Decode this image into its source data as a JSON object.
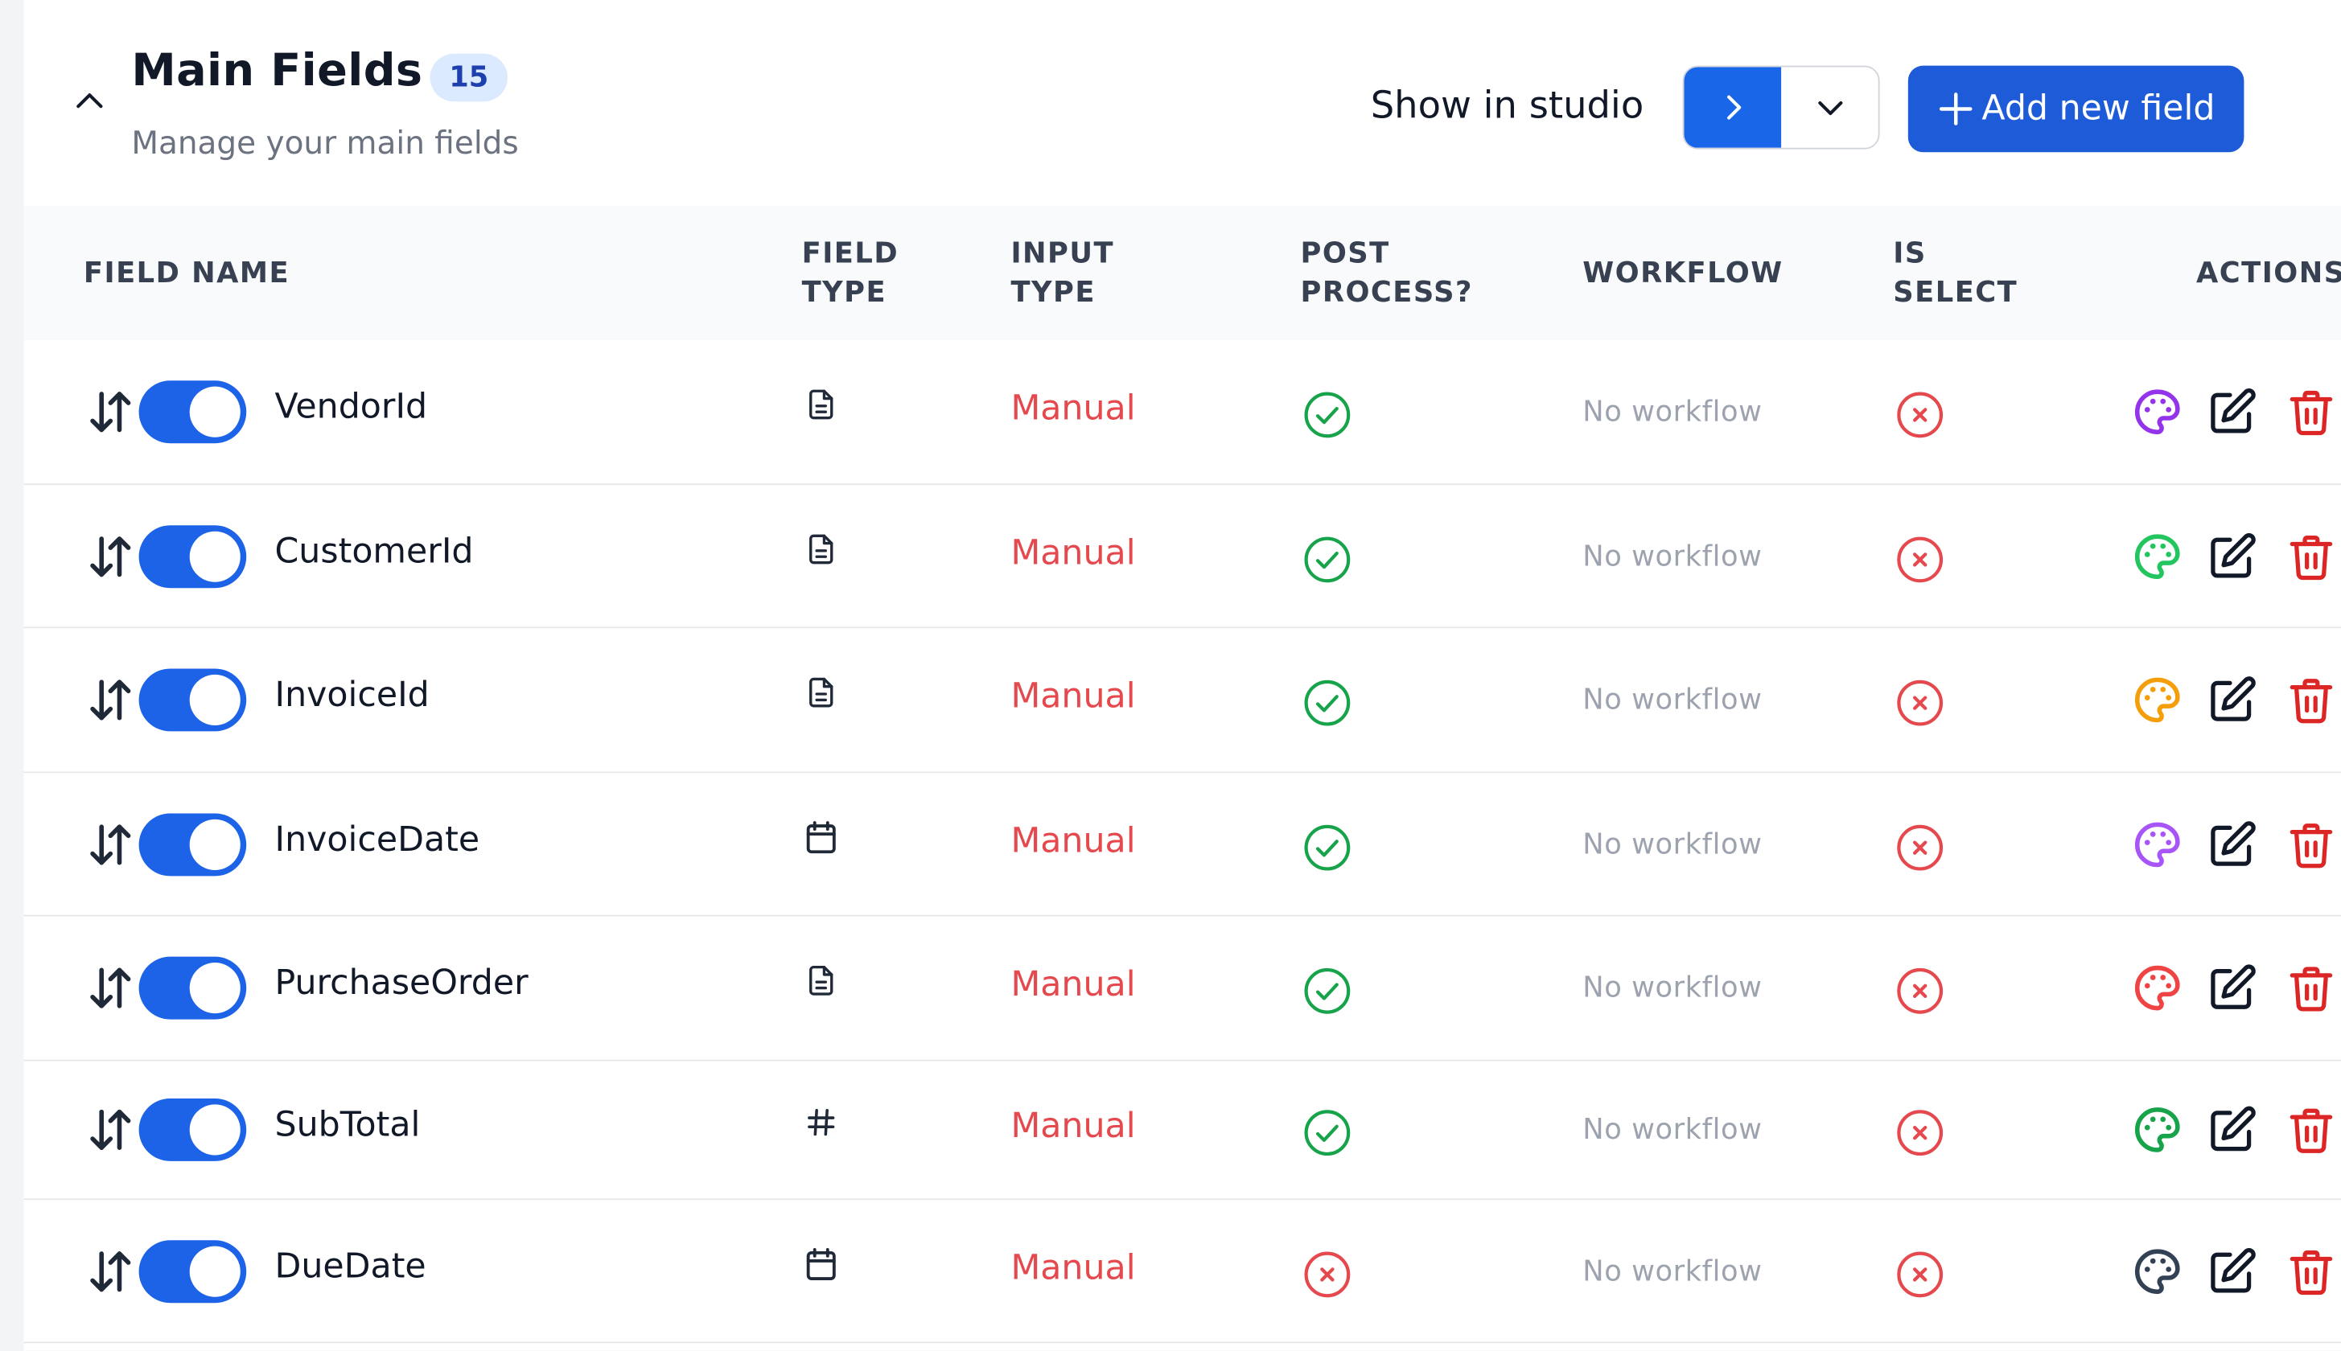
{
  "header": {
    "title": "Main Fields",
    "count": "15",
    "subtitle": "Manage your main fields",
    "studio_label": "Show in studio",
    "add_label": "Add new field"
  },
  "columns": {
    "field_name": "FIELD NAME",
    "field_type_1": "FIELD",
    "field_type_2": "TYPE",
    "input_type_1": "INPUT",
    "input_type_2": "TYPE",
    "post_process_1": "POST",
    "post_process_2": "PROCESS?",
    "workflow": "WORKFLOW",
    "is_select_1": "IS",
    "is_select_2": "SELECT",
    "actions": "ACTIONS"
  },
  "rows": [
    {
      "name": "VendorId",
      "field_type": "text",
      "input_type": "Manual",
      "post_process": true,
      "workflow": "No workflow",
      "is_select": false,
      "enabled": true,
      "palette_color": "#9333ea"
    },
    {
      "name": "CustomerId",
      "field_type": "text",
      "input_type": "Manual",
      "post_process": true,
      "workflow": "No workflow",
      "is_select": false,
      "enabled": true,
      "palette_color": "#22c55e"
    },
    {
      "name": "InvoiceId",
      "field_type": "text",
      "input_type": "Manual",
      "post_process": true,
      "workflow": "No workflow",
      "is_select": false,
      "enabled": true,
      "palette_color": "#f59e0b"
    },
    {
      "name": "InvoiceDate",
      "field_type": "date",
      "input_type": "Manual",
      "post_process": true,
      "workflow": "No workflow",
      "is_select": false,
      "enabled": true,
      "palette_color": "#a855f7"
    },
    {
      "name": "PurchaseOrder",
      "field_type": "text",
      "input_type": "Manual",
      "post_process": true,
      "workflow": "No workflow",
      "is_select": false,
      "enabled": true,
      "palette_color": "#ef4444"
    },
    {
      "name": "SubTotal",
      "field_type": "number",
      "input_type": "Manual",
      "post_process": true,
      "workflow": "No workflow",
      "is_select": false,
      "enabled": true,
      "palette_color": "#16a34a"
    },
    {
      "name": "DueDate",
      "field_type": "date",
      "input_type": "Manual",
      "post_process": false,
      "workflow": "No workflow",
      "is_select": false,
      "enabled": true,
      "palette_color": "#334155"
    }
  ],
  "colors": {
    "primary": "#1d63e8",
    "success": "#16a34a",
    "danger": "#e5484d",
    "muted": "#9ca3af"
  },
  "icons": {
    "collapse": "chevron-up-icon",
    "studio_open": "chevron-right-icon",
    "studio_dropdown": "chevron-down-icon",
    "add": "plus-icon",
    "drag": "sort-arrows-icon",
    "text_type": "document-icon",
    "date_type": "calendar-icon",
    "number_type": "hash-icon",
    "yes": "check-circle-icon",
    "no": "x-circle-icon",
    "palette": "palette-icon",
    "edit": "edit-icon",
    "delete": "trash-icon"
  }
}
